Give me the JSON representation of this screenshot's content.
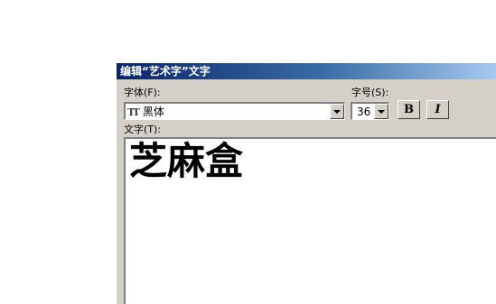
{
  "dialog": {
    "title": "编辑“艺术字”文字",
    "font_label": "字体(F):",
    "font_value": "黑体",
    "size_label": "字号(S):",
    "size_value": "36",
    "bold_label": "B",
    "italic_label": "I",
    "text_label": "文字(T):",
    "text_value": "芝麻盒"
  },
  "colors": {
    "titlebar_start": "#0a246a",
    "titlebar_end": "#a6caf0",
    "dialog_face": "#d4d0c8"
  },
  "icons": {
    "font_type_icon": "truetype-icon",
    "dropdown_icon": "chevron-down-icon"
  }
}
